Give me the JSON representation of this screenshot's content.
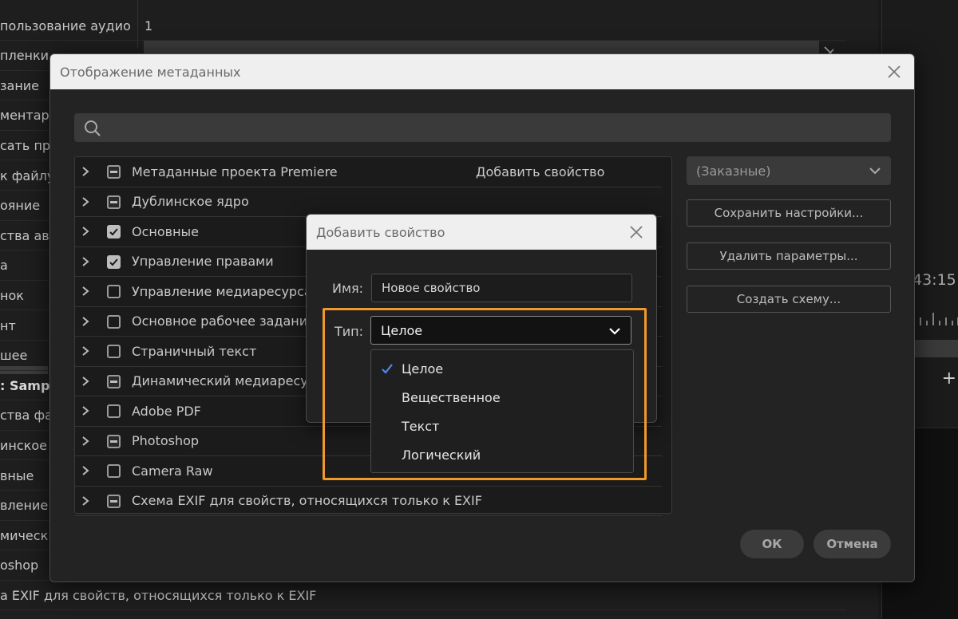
{
  "background": {
    "top_value": "1",
    "rows": [
      "пользование аудио",
      "пленки",
      "зание",
      "ментарий",
      "сать при",
      "к файлу",
      "ояние",
      "ства авто",
      "а",
      "нок",
      "нт",
      "шее",
      ": Sample",
      "ства фай",
      "инское я",
      "вные",
      "вление п",
      "мическ",
      "oshop",
      "а EXIF для свойств, относящихся только к EXIF"
    ],
    "timecode": "43:15"
  },
  "dialog": {
    "title": "Отображение метаданных",
    "search_placeholder": "",
    "tree": [
      {
        "name": "Метаданные проекта Premiere",
        "state": "partial",
        "extra": "Добавить свойство"
      },
      {
        "name": "Дублинское ядро",
        "state": "partial"
      },
      {
        "name": "Основные",
        "state": "checked"
      },
      {
        "name": "Управление правами",
        "state": "checked"
      },
      {
        "name": "Управление медиаресурсами",
        "state": "unchecked"
      },
      {
        "name": "Основное рабочее задание",
        "state": "unchecked"
      },
      {
        "name": "Страничный текст",
        "state": "unchecked"
      },
      {
        "name": "Динамический медиаресурс",
        "state": "partial"
      },
      {
        "name": "Adobe PDF",
        "state": "unchecked"
      },
      {
        "name": "Photoshop",
        "state": "partial"
      },
      {
        "name": "Camera Raw",
        "state": "unchecked"
      },
      {
        "name": "Схема EXIF для свойств, относящихся только к EXIF",
        "state": "partial"
      }
    ],
    "preset_select": "(Заказные)",
    "save_settings": "Сохранить настройки...",
    "delete_params": "Удалить параметры...",
    "create_schema": "Создать схему...",
    "ok": "ОК",
    "cancel": "Отмена"
  },
  "add_property": {
    "title": "Добавить свойство",
    "name_label": "Имя:",
    "name_value": "Новое свойство",
    "type_label": "Тип:",
    "type_value": "Целое",
    "options": [
      "Целое",
      "Вещественное",
      "Текст",
      "Логический"
    ],
    "selected_option": "Целое"
  },
  "colors": {
    "highlight": "#f0992c",
    "checkmark": "#4a8cf0"
  }
}
